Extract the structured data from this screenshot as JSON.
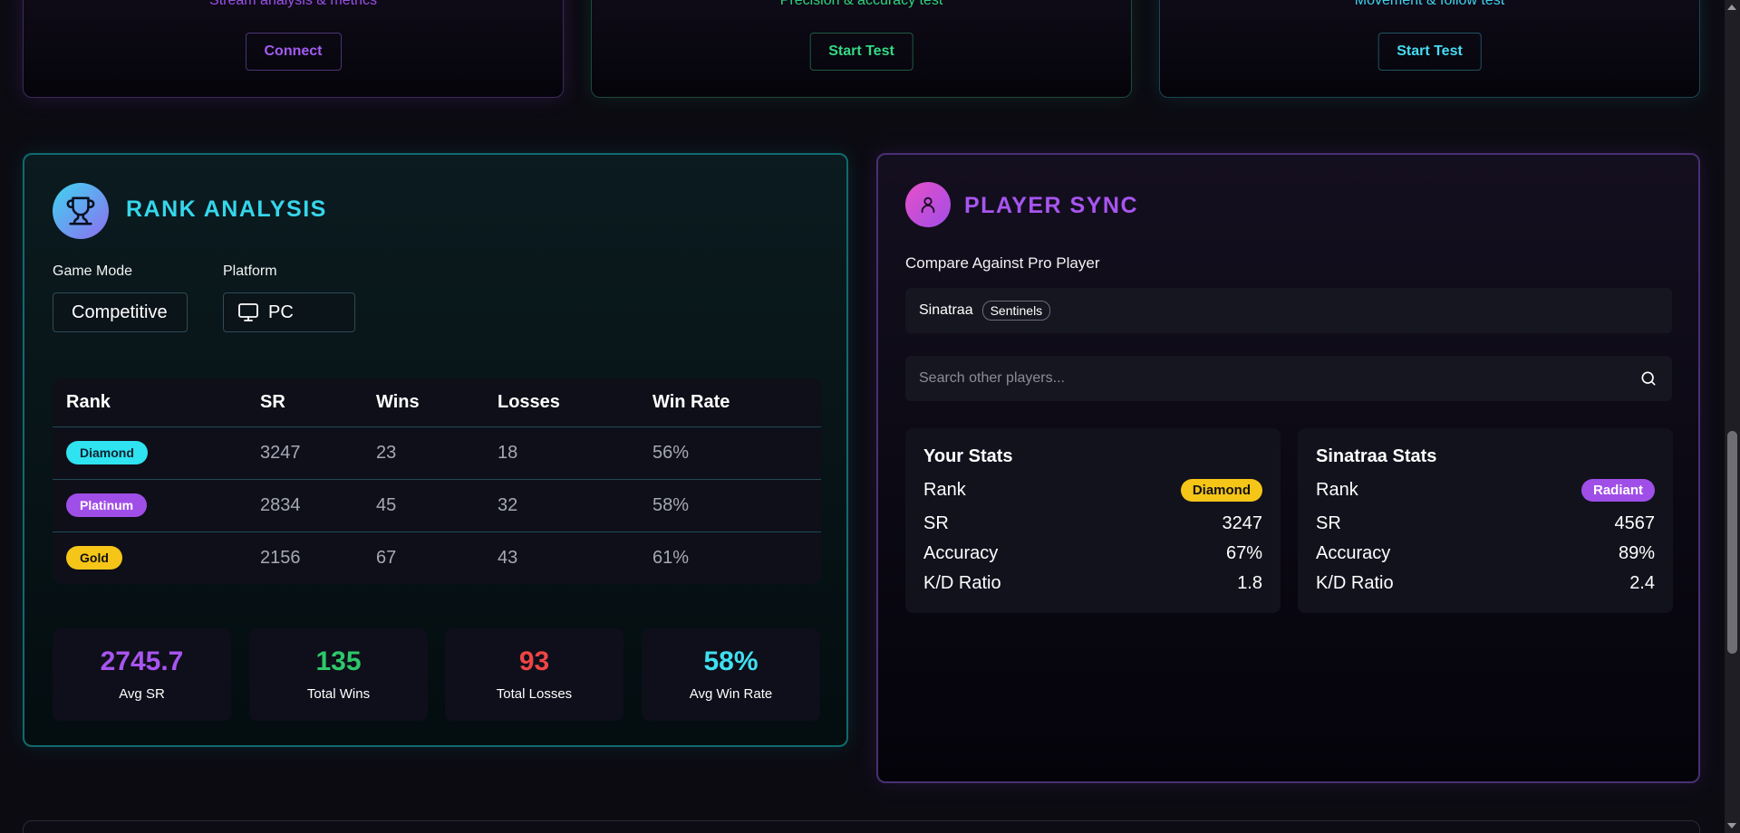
{
  "top_cards": [
    {
      "subtitle": "Stream analysis & metrics",
      "button": "Connect"
    },
    {
      "subtitle": "Precision & accuracy test",
      "button": "Start Test"
    },
    {
      "subtitle": "Movement & follow test",
      "button": "Start Test"
    }
  ],
  "rank_analysis": {
    "icon": "trophy-icon",
    "title": "RANK ANALYSIS",
    "game_mode_label": "Game Mode",
    "game_mode_value": "Competitive",
    "platform_label": "Platform",
    "platform_icon": "monitor-icon",
    "platform_value": "PC",
    "table": {
      "headers": [
        "Rank",
        "SR",
        "Wins",
        "Losses",
        "Win Rate"
      ],
      "rows": [
        {
          "rank": "Diamond",
          "sr": "3247",
          "wins": "23",
          "losses": "18",
          "win_rate": "56%"
        },
        {
          "rank": "Platinum",
          "sr": "2834",
          "wins": "45",
          "losses": "32",
          "win_rate": "58%"
        },
        {
          "rank": "Gold",
          "sr": "2156",
          "wins": "67",
          "losses": "43",
          "win_rate": "61%"
        }
      ]
    },
    "summary": [
      {
        "value": "2745.7",
        "label": "Avg SR",
        "color": "#a855f0"
      },
      {
        "value": "135",
        "label": "Total Wins",
        "color": "#2ec76a"
      },
      {
        "value": "93",
        "label": "Total Losses",
        "color": "#ef4444"
      },
      {
        "value": "58%",
        "label": "Avg Win Rate",
        "color": "#3fe0f0"
      }
    ]
  },
  "player_sync": {
    "icon": "user-icon",
    "title": "PLAYER SYNC",
    "compare_label": "Compare Against Pro Player",
    "pro_name": "Sinatraa",
    "pro_team": "Sentinels",
    "search_placeholder": "Search other players...",
    "your_stats": {
      "title": "Your Stats",
      "rank_label": "Rank",
      "rank": "Diamond",
      "sr_label": "SR",
      "sr": "3247",
      "accuracy_label": "Accuracy",
      "accuracy": "67%",
      "kd_label": "K/D Ratio",
      "kd": "1.8"
    },
    "pro_stats": {
      "title": "Sinatraa Stats",
      "rank_label": "Rank",
      "rank": "Radiant",
      "sr_label": "SR",
      "sr": "4567",
      "accuracy_label": "Accuracy",
      "accuracy": "89%",
      "kd_label": "K/D Ratio",
      "kd": "2.4"
    }
  }
}
